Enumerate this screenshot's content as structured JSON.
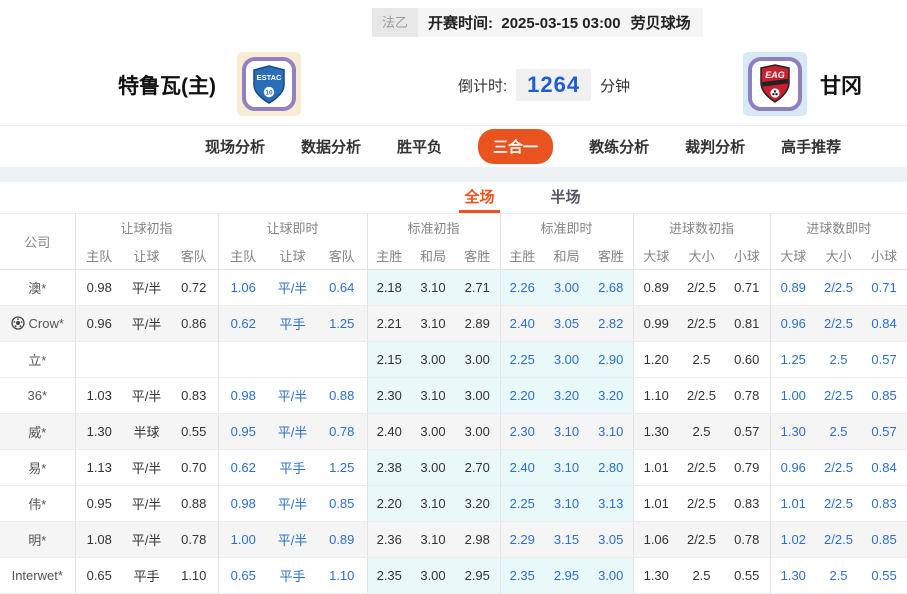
{
  "colors": {
    "accent": "#e8531f",
    "live_blue": "#2a6fc9",
    "countdown_blue": "#1e5fd0",
    "standard_tint": "#e9f8f8",
    "row_shade": "#f5f5f5"
  },
  "top_bar": {
    "league": "法乙",
    "kickoff_label": "开赛时间:",
    "kickoff_time": "2025-03-15 03:00",
    "venue": "劳贝球场"
  },
  "match": {
    "home_name": "特鲁瓦(主)",
    "home_logo_text": "ESTAC",
    "home_logo_number": "10",
    "away_name": "甘冈",
    "away_logo_text": "EAG",
    "countdown_label": "倒计时:",
    "countdown_value": "1264",
    "countdown_unit": "分钟"
  },
  "nav": {
    "items": [
      {
        "label": "现场分析",
        "active": false
      },
      {
        "label": "数据分析",
        "active": false
      },
      {
        "label": "胜平负",
        "active": false
      },
      {
        "label": "三合一",
        "active": true
      },
      {
        "label": "教练分析",
        "active": false
      },
      {
        "label": "裁判分析",
        "active": false
      },
      {
        "label": "高手推荐",
        "active": false
      }
    ]
  },
  "subtabs": {
    "items": [
      {
        "label": "全场",
        "active": true
      },
      {
        "label": "半场",
        "active": false
      }
    ]
  },
  "table": {
    "company_header": "公司",
    "groups": [
      {
        "label": "让球初指",
        "cols": [
          "主队",
          "让球",
          "客队"
        ],
        "live": false,
        "tint": false
      },
      {
        "label": "让球即时",
        "cols": [
          "主队",
          "让球",
          "客队"
        ],
        "live": true,
        "tint": false
      },
      {
        "label": "标准初指",
        "cols": [
          "主胜",
          "和局",
          "客胜"
        ],
        "live": false,
        "tint": true
      },
      {
        "label": "标准即时",
        "cols": [
          "主胜",
          "和局",
          "客胜"
        ],
        "live": true,
        "tint": true
      },
      {
        "label": "进球数初指",
        "cols": [
          "大球",
          "大小",
          "小球"
        ],
        "live": false,
        "tint": false
      },
      {
        "label": "进球数即时",
        "cols": [
          "大球",
          "大小",
          "小球"
        ],
        "live": true,
        "tint": false
      }
    ],
    "rows": [
      {
        "company": "澳*",
        "icon": null,
        "shaded": false,
        "cells": [
          [
            "0.98",
            "平/半",
            "0.72"
          ],
          [
            "1.06",
            "平/半",
            "0.64"
          ],
          [
            "2.18",
            "3.10",
            "2.71"
          ],
          [
            "2.26",
            "3.00",
            "2.68"
          ],
          [
            "0.89",
            "2/2.5",
            "0.71"
          ],
          [
            "0.89",
            "2/2.5",
            "0.71"
          ]
        ]
      },
      {
        "company": "Crow*",
        "icon": "football-icon",
        "shaded": true,
        "cells": [
          [
            "0.96",
            "平/半",
            "0.86"
          ],
          [
            "0.62",
            "平手",
            "1.25"
          ],
          [
            "2.21",
            "3.10",
            "2.89"
          ],
          [
            "2.40",
            "3.05",
            "2.82"
          ],
          [
            "0.99",
            "2/2.5",
            "0.81"
          ],
          [
            "0.96",
            "2/2.5",
            "0.84"
          ]
        ]
      },
      {
        "company": "立*",
        "icon": null,
        "shaded": false,
        "cells": [
          [
            "",
            "",
            ""
          ],
          [
            "",
            "",
            ""
          ],
          [
            "2.15",
            "3.00",
            "3.00"
          ],
          [
            "2.25",
            "3.00",
            "2.90"
          ],
          [
            "1.20",
            "2.5",
            "0.60"
          ],
          [
            "1.25",
            "2.5",
            "0.57"
          ]
        ]
      },
      {
        "company": "36*",
        "icon": null,
        "shaded": false,
        "cells": [
          [
            "1.03",
            "平/半",
            "0.83"
          ],
          [
            "0.98",
            "平/半",
            "0.88"
          ],
          [
            "2.30",
            "3.10",
            "3.00"
          ],
          [
            "2.20",
            "3.20",
            "3.20"
          ],
          [
            "1.10",
            "2/2.5",
            "0.78"
          ],
          [
            "1.00",
            "2/2.5",
            "0.85"
          ]
        ]
      },
      {
        "company": "威*",
        "icon": null,
        "shaded": true,
        "cells": [
          [
            "1.30",
            "半球",
            "0.55"
          ],
          [
            "0.95",
            "平/半",
            "0.78"
          ],
          [
            "2.40",
            "3.00",
            "3.00"
          ],
          [
            "2.30",
            "3.10",
            "3.10"
          ],
          [
            "1.30",
            "2.5",
            "0.57"
          ],
          [
            "1.30",
            "2.5",
            "0.57"
          ]
        ]
      },
      {
        "company": "易*",
        "icon": null,
        "shaded": false,
        "cells": [
          [
            "1.13",
            "平/半",
            "0.70"
          ],
          [
            "0.62",
            "平手",
            "1.25"
          ],
          [
            "2.38",
            "3.00",
            "2.70"
          ],
          [
            "2.40",
            "3.10",
            "2.80"
          ],
          [
            "1.01",
            "2/2.5",
            "0.79"
          ],
          [
            "0.96",
            "2/2.5",
            "0.84"
          ]
        ]
      },
      {
        "company": "伟*",
        "icon": null,
        "shaded": false,
        "cells": [
          [
            "0.95",
            "平/半",
            "0.88"
          ],
          [
            "0.98",
            "平/半",
            "0.85"
          ],
          [
            "2.20",
            "3.10",
            "3.20"
          ],
          [
            "2.25",
            "3.10",
            "3.13"
          ],
          [
            "1.01",
            "2/2.5",
            "0.83"
          ],
          [
            "1.01",
            "2/2.5",
            "0.83"
          ]
        ]
      },
      {
        "company": "明*",
        "icon": null,
        "shaded": true,
        "cells": [
          [
            "1.08",
            "平/半",
            "0.78"
          ],
          [
            "1.00",
            "平/半",
            "0.89"
          ],
          [
            "2.36",
            "3.10",
            "2.98"
          ],
          [
            "2.29",
            "3.15",
            "3.05"
          ],
          [
            "1.06",
            "2/2.5",
            "0.78"
          ],
          [
            "1.02",
            "2/2.5",
            "0.85"
          ]
        ]
      },
      {
        "company": "Interwet*",
        "icon": null,
        "shaded": false,
        "cells": [
          [
            "0.65",
            "平手",
            "1.10"
          ],
          [
            "0.65",
            "平手",
            "1.10"
          ],
          [
            "2.35",
            "3.00",
            "2.95"
          ],
          [
            "2.35",
            "2.95",
            "3.00"
          ],
          [
            "1.30",
            "2.5",
            "0.55"
          ],
          [
            "1.30",
            "2.5",
            "0.55"
          ]
        ]
      }
    ]
  }
}
